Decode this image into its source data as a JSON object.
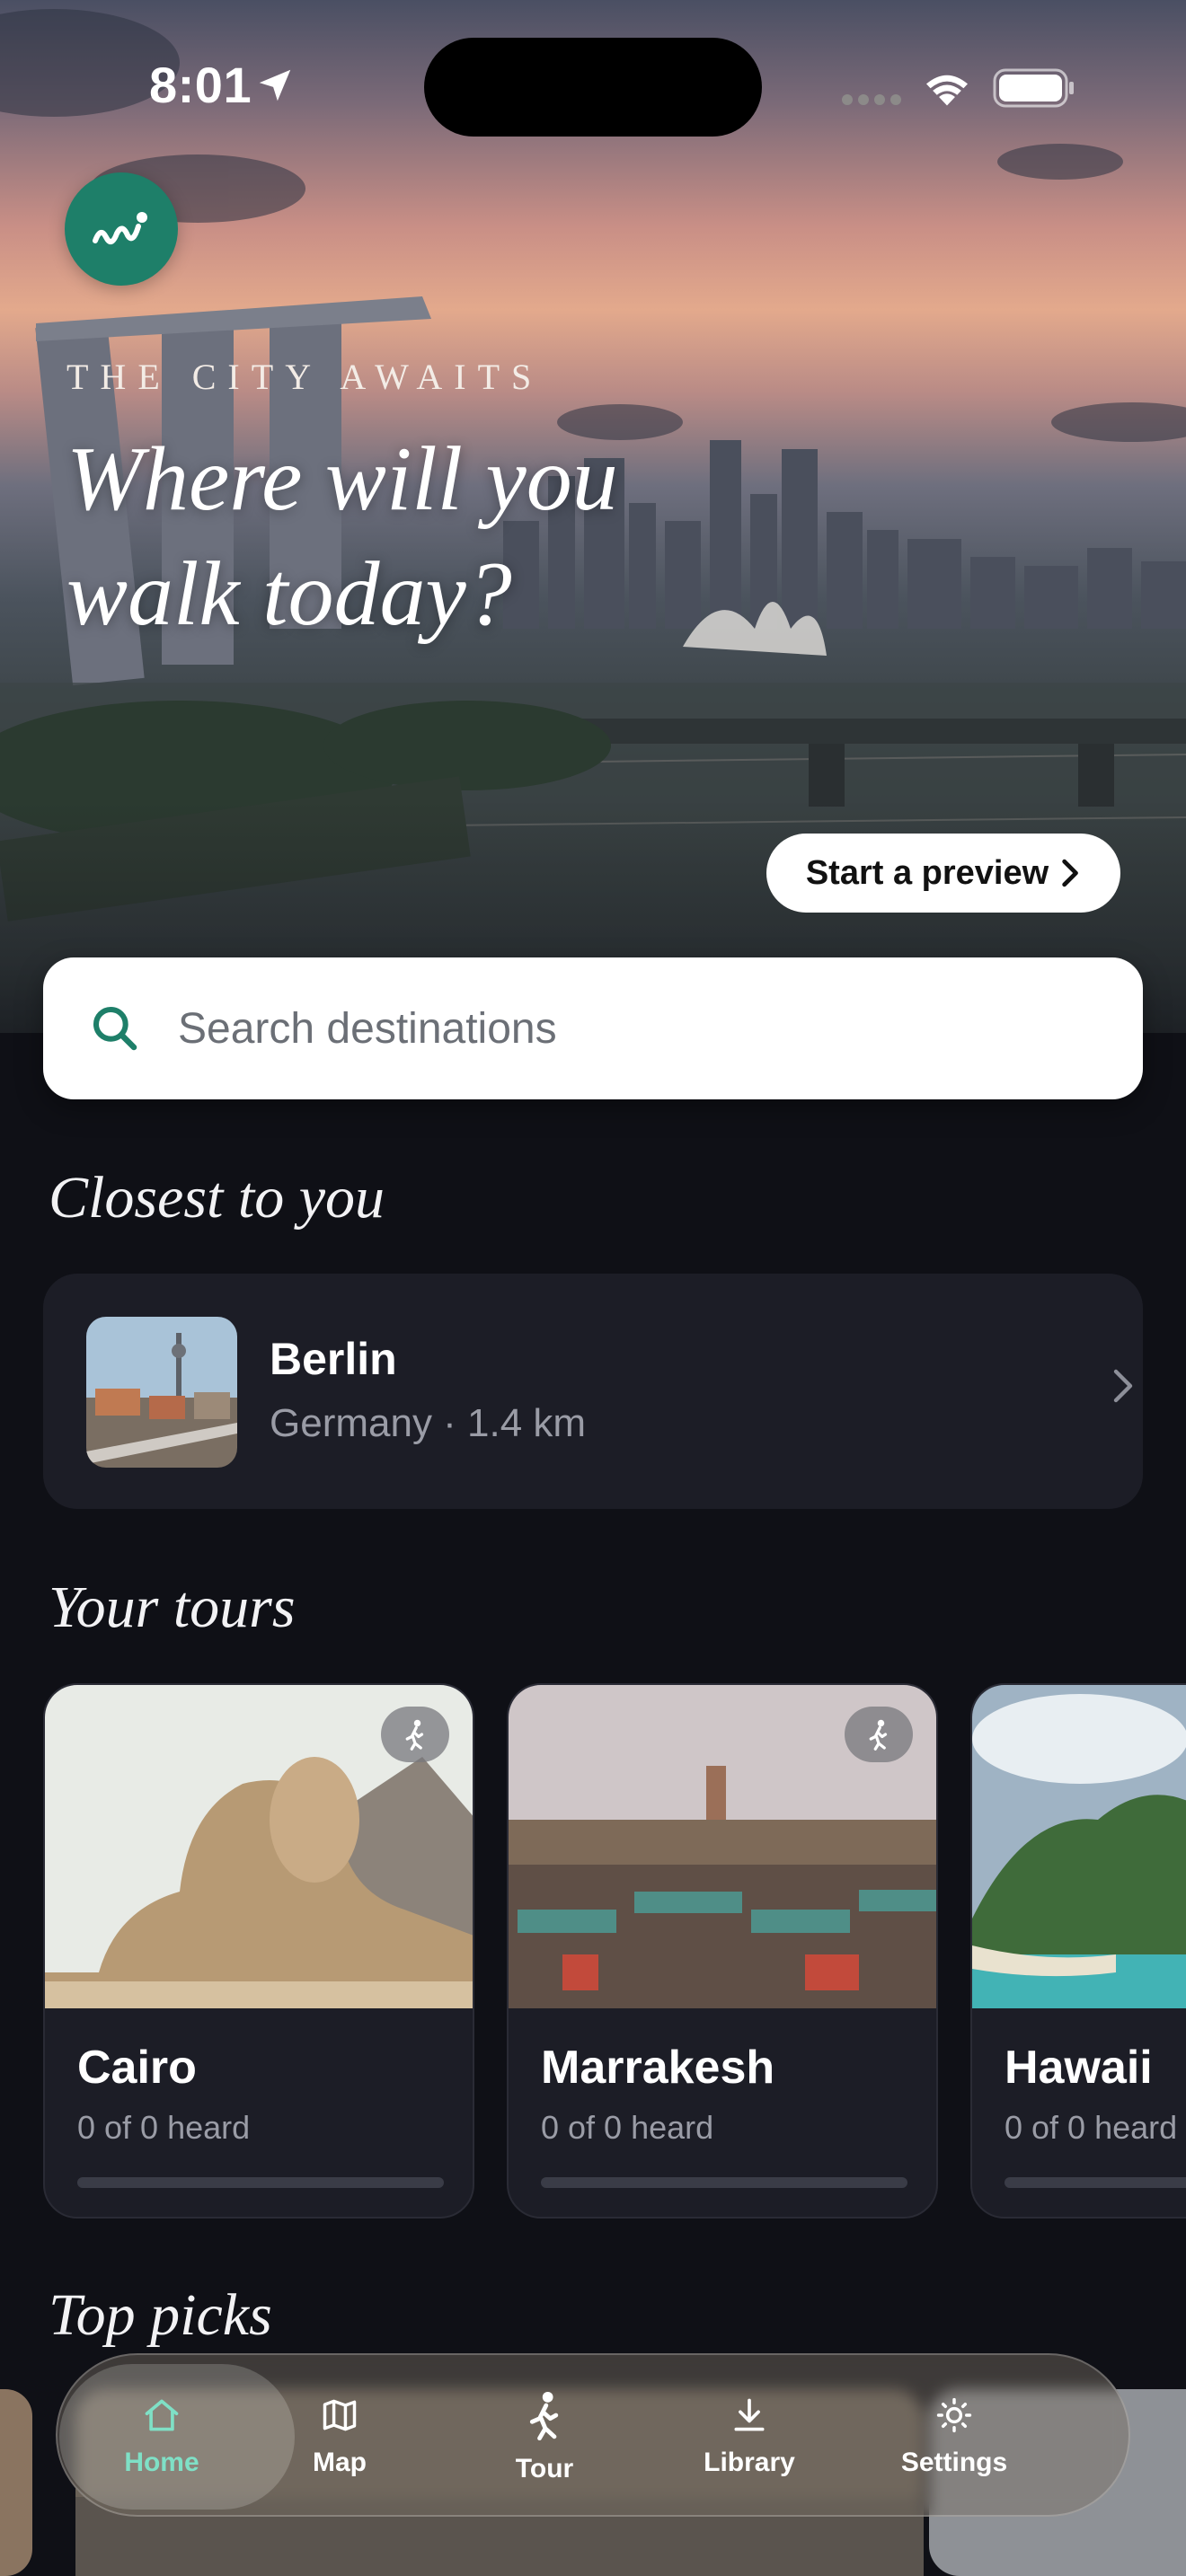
{
  "status_bar": {
    "time": "8:01"
  },
  "hero": {
    "kicker": "THE CITY AWAITS",
    "headline": "Where will you walk today?",
    "preview_button": "Start a preview"
  },
  "search": {
    "placeholder": "Search destinations"
  },
  "closest": {
    "title": "Closest to you",
    "city": "Berlin",
    "meta": "Germany · 1.4 km"
  },
  "tours": {
    "title": "Your tours",
    "items": [
      {
        "name": "Cairo",
        "heard": "0 of 0 heard",
        "progress": 0
      },
      {
        "name": "Marrakesh",
        "heard": "0 of 0 heard",
        "progress": 0
      },
      {
        "name": "Hawaii",
        "heard": "0 of 0 heard",
        "progress": 0
      }
    ]
  },
  "top_picks": {
    "title": "Top picks"
  },
  "tabbar": {
    "items": [
      {
        "label": "Home",
        "icon": "home-icon",
        "active": true
      },
      {
        "label": "Map",
        "icon": "map-icon",
        "active": false
      },
      {
        "label": "Tour",
        "icon": "walking-icon",
        "active": false
      },
      {
        "label": "Library",
        "icon": "download-icon",
        "active": false
      },
      {
        "label": "Settings",
        "icon": "sun-icon",
        "active": false
      }
    ]
  },
  "colors": {
    "accent": "#1e7f69",
    "active_tab": "#7fe0c6",
    "background": "#0f1016",
    "card": "#1c1d26"
  }
}
